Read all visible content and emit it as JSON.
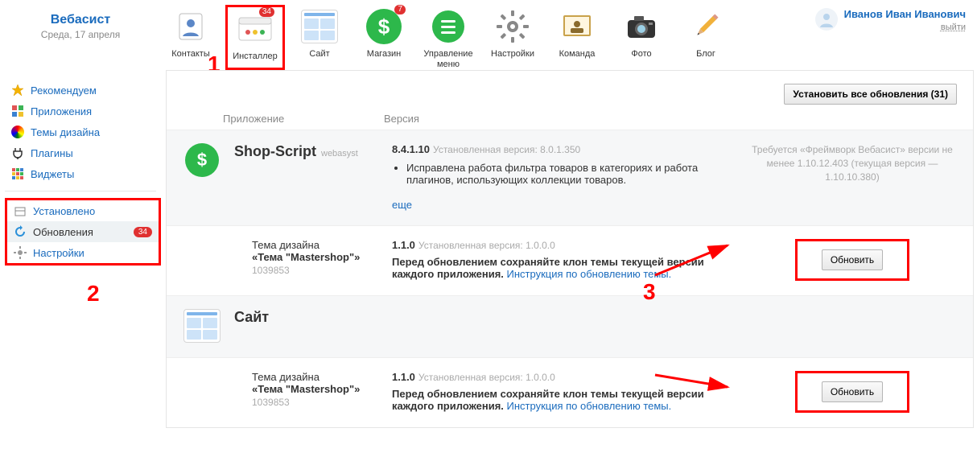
{
  "header": {
    "brand_title": "Вебасист",
    "brand_date": "Среда, 17 апреля",
    "apps": [
      {
        "key": "contacts",
        "label": "Контакты",
        "active": false,
        "badge": null
      },
      {
        "key": "installer",
        "label": "Инсталлер",
        "active": true,
        "badge": "34"
      },
      {
        "key": "site",
        "label": "Сайт",
        "active": false,
        "badge": null
      },
      {
        "key": "shop",
        "label": "Магазин",
        "active": false,
        "badge": "7"
      },
      {
        "key": "menu",
        "label": "Управление меню",
        "active": false,
        "badge": null
      },
      {
        "key": "settings",
        "label": "Настройки",
        "active": false,
        "badge": null
      },
      {
        "key": "team",
        "label": "Команда",
        "active": false,
        "badge": null
      },
      {
        "key": "photo",
        "label": "Фото",
        "active": false,
        "badge": null
      },
      {
        "key": "blog",
        "label": "Блог",
        "active": false,
        "badge": null
      }
    ],
    "user": {
      "name": "Иванов Иван Иванович",
      "logout": "выйти"
    }
  },
  "sidebar": {
    "group1": [
      {
        "key": "recommend",
        "label": "Рекомендуем",
        "icon": "star"
      },
      {
        "key": "apps",
        "label": "Приложения",
        "icon": "apps"
      },
      {
        "key": "themes",
        "label": "Темы дизайна",
        "icon": "palette"
      },
      {
        "key": "plugins",
        "label": "Плагины",
        "icon": "plug"
      },
      {
        "key": "widgets",
        "label": "Виджеты",
        "icon": "widgets"
      }
    ],
    "group2": [
      {
        "key": "installed",
        "label": "Установлено",
        "icon": "box"
      },
      {
        "key": "updates",
        "label": "Обновления",
        "icon": "reload",
        "badge": "34",
        "selected": true
      },
      {
        "key": "settings",
        "label": "Настройки",
        "icon": "gear"
      }
    ]
  },
  "content": {
    "update_all_label": "Установить все обновления (31)",
    "columns": {
      "app": "Приложение",
      "version": "Версия"
    },
    "more_label": "еще",
    "update_btn": "Обновить",
    "items": [
      {
        "type": "app",
        "name": "Shop-Script",
        "vendor": "webasyst",
        "new_version": "8.4.1.10",
        "installed_label": "Установленная версия: 8.0.1.350",
        "notes": [
          "Исправлена работа фильтра товаров в категориях и работа плагинов, использующих коллекции товаров."
        ],
        "requirement": "Требуется «Фреймворк Вебасист» версии не менее 1.10.12.403 (текущая версия — 1.10.10.380)"
      },
      {
        "type": "theme",
        "pre_label": "Тема дизайна",
        "name": "«Тема \"Mastershop\"»",
        "code": "1039853",
        "new_version": "1.1.0",
        "installed_label": "Установленная версия: 1.0.0.0",
        "warn_pre": "Перед обновлением сохраняйте клон темы текущей версии каждого приложения. ",
        "warn_link": "Инструкция по обновлению темы."
      },
      {
        "type": "app_header",
        "name": "Сайт"
      },
      {
        "type": "theme",
        "pre_label": "Тема дизайна",
        "name": "«Тема \"Mastershop\"»",
        "code": "1039853",
        "new_version": "1.1.0",
        "installed_label": "Установленная версия: 1.0.0.0",
        "warn_pre": "Перед обновлением сохраняйте клон темы текущей версии каждого приложения. ",
        "warn_link": "Инструкция по обновлению темы."
      }
    ]
  },
  "annotations": {
    "one": "1",
    "two": "2",
    "three": "3"
  }
}
